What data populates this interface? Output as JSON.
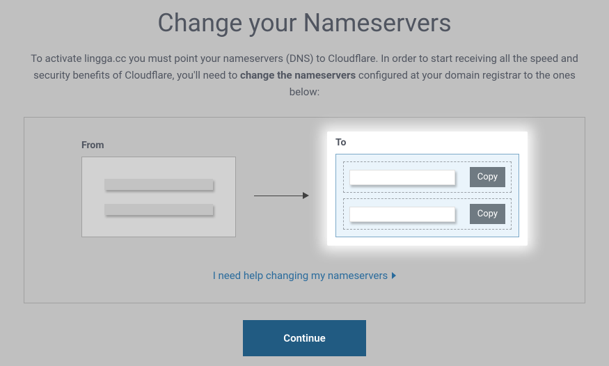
{
  "title": "Change your Nameservers",
  "intro": {
    "pre": "To activate lingga.cc you must point your nameservers (DNS) to Cloudflare. In order to start receiving all the speed and security benefits of Cloudflare, you'll need to ",
    "bold": "change the nameservers",
    "post": " configured at your domain registrar to the ones below:"
  },
  "from_label": "From",
  "to_label": "To",
  "nameservers": [
    {
      "value": "",
      "copy_label": "Copy"
    },
    {
      "value": "",
      "copy_label": "Copy"
    }
  ],
  "help_link": "I need help changing my nameservers",
  "continue_label": "Continue"
}
